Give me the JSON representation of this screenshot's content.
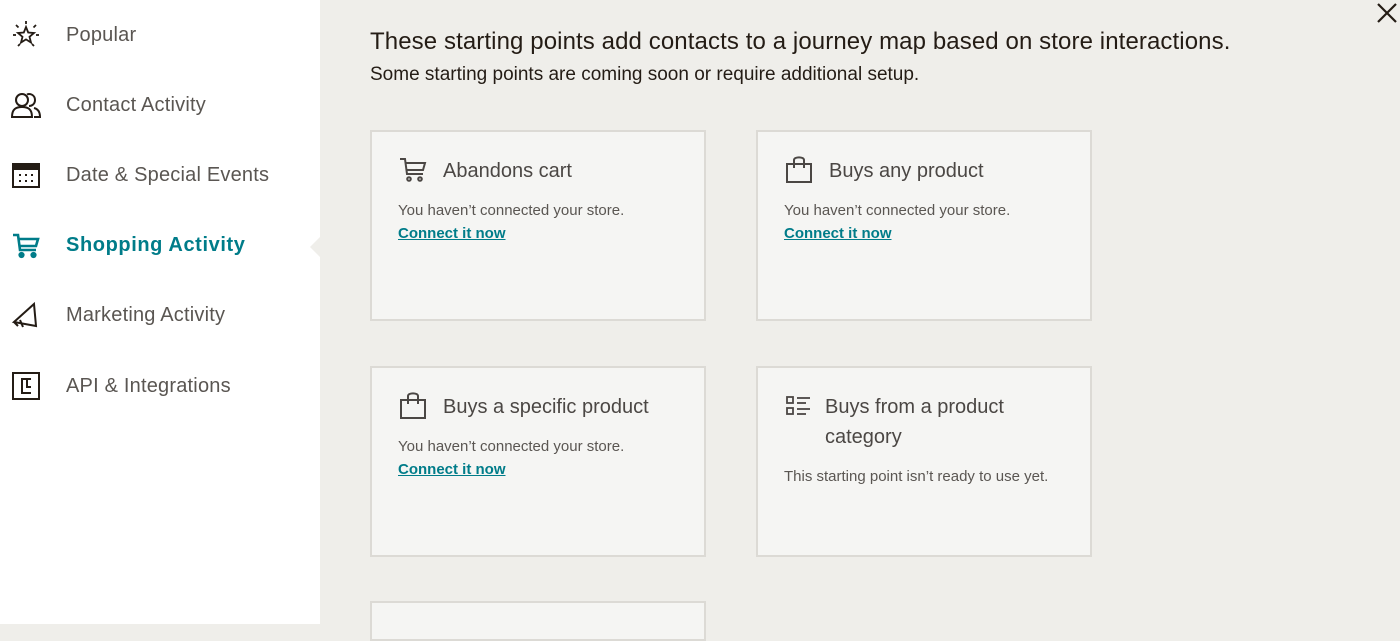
{
  "sidebar": {
    "items": [
      {
        "label": "Popular",
        "icon": "sparkle-icon"
      },
      {
        "label": "Contact Activity",
        "icon": "contacts-icon"
      },
      {
        "label": "Date & Special Events",
        "icon": "calendar-icon"
      },
      {
        "label": "Shopping Activity",
        "icon": "cart-icon",
        "active": true
      },
      {
        "label": "Marketing Activity",
        "icon": "megaphone-icon"
      },
      {
        "label": "API & Integrations",
        "icon": "integration-icon"
      }
    ]
  },
  "header": {
    "title": "These starting points add contacts to a journey map based on store interactions.",
    "subtitle": "Some starting points are coming soon or require additional setup."
  },
  "cards": [
    {
      "title": "Abandons cart",
      "icon": "cart-icon",
      "text": "You haven’t connected your store.",
      "link": "Connect it now"
    },
    {
      "title": "Buys any product",
      "icon": "shopping-bag-icon",
      "text": "You haven’t connected your store.",
      "link": "Connect it now"
    },
    {
      "title": "Buys a specific product",
      "icon": "shopping-bag-icon",
      "text": "You haven’t connected your store.",
      "link": "Connect it now"
    },
    {
      "title": "Buys from a product category",
      "icon": "category-list-icon",
      "text": "This starting point isn’t ready to use yet."
    }
  ],
  "colors": {
    "accent": "#007c89",
    "background": "#efeeea",
    "sidebar": "#ffffff",
    "card": "#f5f5f3",
    "card_border": "#dcdad5"
  },
  "close_icon": "close-icon"
}
